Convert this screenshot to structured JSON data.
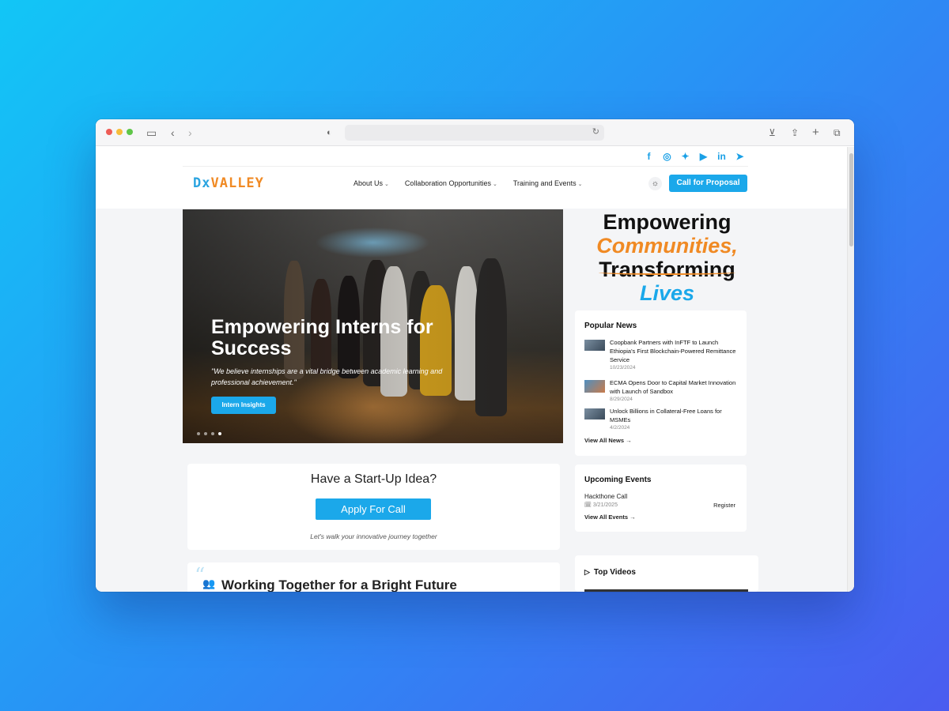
{
  "browser": {
    "url": "",
    "icons": [
      "sidebar-icon",
      "back-icon",
      "forward-icon",
      "shield-icon",
      "reload-icon",
      "download-icon",
      "share-icon",
      "new-tab-icon",
      "tabs-icon"
    ]
  },
  "colors": {
    "accent": "#1ba8ea",
    "brand_orange": "#f08a24",
    "text": "#222222"
  },
  "socials": [
    "facebook-icon",
    "instagram-icon",
    "twitter-icon",
    "youtube-icon",
    "linkedin-icon",
    "telegram-icon"
  ],
  "header": {
    "logo_prefix": "Dx",
    "logo_suffix": "VALLEY",
    "nav": [
      "About Us",
      "Collaboration Opportunities",
      "Training and Events"
    ],
    "cta": "Call for Proposal"
  },
  "hero": {
    "title": "Empowering Interns for Success",
    "quote": "\"We believe internships are a vital bridge between academic learning and professional achievement.\"",
    "button": "Intern Insights",
    "slides": 4,
    "active_slide": 4
  },
  "tagline": {
    "line1": "Empowering",
    "line2": "Communities,",
    "line3": "Transforming",
    "line4": "Lives"
  },
  "popular_news": {
    "title": "Popular News",
    "items": [
      {
        "title": "Coopbank Partners with InFTF to Launch Ethiopia's First Blockchain-Powered Remittance Service",
        "date": "10/23/2024"
      },
      {
        "title": "ECMA Opens Door to Capital Market Innovation with Launch of Sandbox",
        "date": "8/29/2024"
      },
      {
        "title": "Unlock Billions in Collateral-Free Loans for MSMEs",
        "date": "4/2/2024"
      }
    ],
    "view_all": "View All News →"
  },
  "events": {
    "title": "Upcoming Events",
    "name": "Hackthone Call",
    "date": "🗓 3/21/2025",
    "register": "Register",
    "view_all": "View All Events →"
  },
  "videos": {
    "title": "Top Videos"
  },
  "startup": {
    "title": "Have a Start-Up Idea?",
    "button": "Apply For Call",
    "subtitle": "Let's walk your innovative journey together"
  },
  "working": {
    "title": "Working Together for a Bright Future"
  }
}
